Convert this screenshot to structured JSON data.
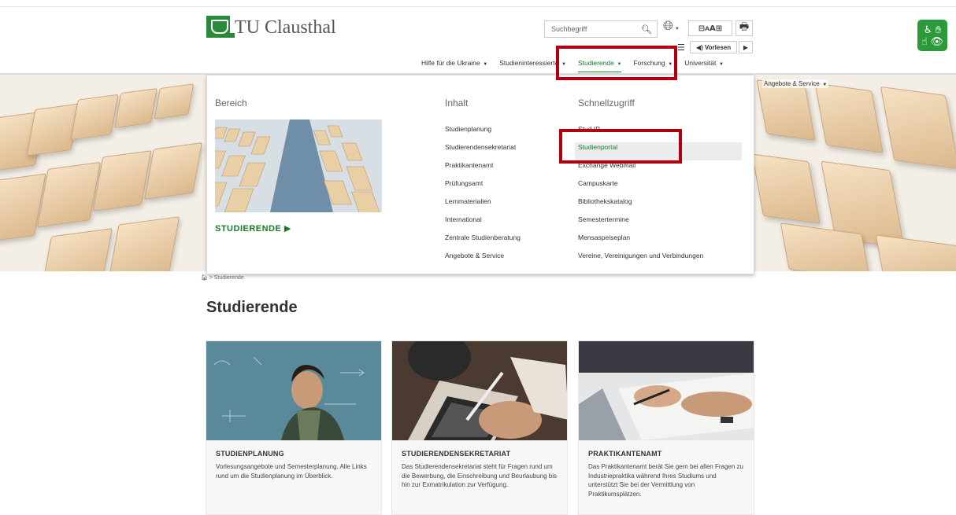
{
  "header": {
    "logo_text": "TU Clausthal",
    "search_placeholder": "Suchbegriff",
    "font_controls": "⊟ᴀ𝗔⊞",
    "vorlesen_label": "◀) Vorlesen"
  },
  "nav": {
    "items": [
      {
        "label": "Hilfe für die Ukraine"
      },
      {
        "label": "Studieninteressierte"
      },
      {
        "label": "Studierende"
      },
      {
        "label": "Forschung"
      },
      {
        "label": "Universität"
      }
    ],
    "secondary": "Angebote & Service"
  },
  "dropdown": {
    "col1_title": "Bereich",
    "col2_title": "Inhalt",
    "col3_title": "Schnellzugriff",
    "section_link": "STUDIERENDE ▶",
    "inhalt": [
      "Studienplanung",
      "Studierendensekretariat",
      "Praktikantenamt",
      "Prüfungsamt",
      "Lernmaterialien",
      "International",
      "Zentrale Studienberatung",
      "Angebote & Service"
    ],
    "schnellzugriff": [
      "Stud.IP",
      "Studienportal",
      "Exchange Webmail",
      "Campuskarte",
      "Bibliothekskatalog",
      "Semestertermine",
      "Mensaspeiseplan",
      "Vereine, Vereinigungen und Verbindungen"
    ]
  },
  "breadcrumb": {
    "current": "Studierende"
  },
  "page_title": "Studierende",
  "cards": [
    {
      "title": "STUDIENPLANUNG",
      "text": "Vorlesungsangebote und Semesterplanung. Alle Links rund um die Studienplanung im Überblick."
    },
    {
      "title": "STUDIERENDENSEKRETARIAT",
      "text": "Das Studierendensekretariat steht für Fragen rund um die Bewerbung, die Einschreibung und Beurlaubung bis hin zur Exmatrikulation zur Verfügung."
    },
    {
      "title": "PRAKTIKANTENAMT",
      "text": "Das Praktikantenamt berät Sie gern bei allen Fragen zu Industriepraktika während Ihres Studiums und unterstützt Sie bei der Vermittlung von Praktikumsplätzen."
    }
  ],
  "colors": {
    "accent": "#1a7a2a",
    "highlight": "#b00010",
    "access": "#2c9a3a"
  }
}
